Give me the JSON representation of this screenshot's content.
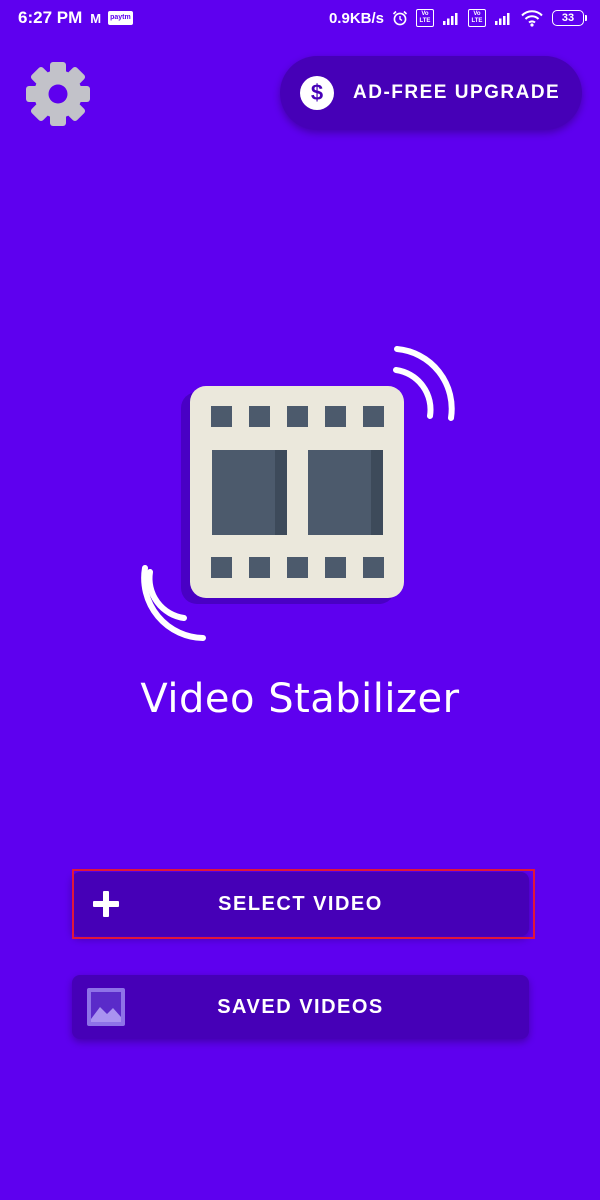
{
  "status_bar": {
    "time": "6:27 PM",
    "left_icons": [
      "gmail-m-icon",
      "paytm-icon"
    ],
    "m_glyph": "M",
    "paytm_text": "paytm",
    "network_speed": "0.9KB/s",
    "volte_text": "Vo LTE",
    "battery_level": "33",
    "right_icons": [
      "alarm-icon",
      "volte-icon",
      "signal-icon",
      "volte-icon",
      "signal-icon",
      "wifi-icon",
      "battery-icon"
    ]
  },
  "toolbar": {
    "settings_icon": "gear-icon",
    "upgrade_icon": "dollar-icon",
    "upgrade_symbol": "$",
    "upgrade_label": "AD-FREE UPGRADE"
  },
  "app": {
    "logo_icon": "film-strip-icon",
    "title": "Video Stabilizer"
  },
  "actions": {
    "select_video_label": "SELECT VIDEO",
    "select_video_icon": "plus-icon",
    "saved_videos_label": "SAVED VIDEOS",
    "saved_videos_icon": "gallery-icon"
  },
  "colors": {
    "background": "#5e00ef",
    "button": "#4600b7",
    "highlight": "#e0173a",
    "film_frame": "#ebe8dc",
    "film_panel": "#4c5a6c"
  }
}
